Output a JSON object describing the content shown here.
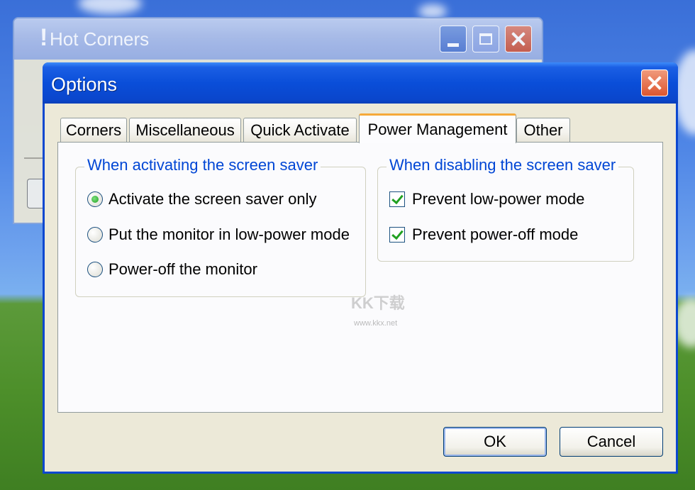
{
  "back_window": {
    "title": "Hot Corners",
    "icon": "exclamation-icon"
  },
  "dialog": {
    "title": "Options",
    "tabs": [
      {
        "label": "Corners",
        "active": false
      },
      {
        "label": "Miscellaneous",
        "active": false
      },
      {
        "label": "Quick Activate",
        "active": false
      },
      {
        "label": "Power Management",
        "active": true
      },
      {
        "label": "Other",
        "active": false
      }
    ],
    "activating_group": {
      "label": "When activating the screen saver",
      "options": [
        {
          "label": "Activate the screen saver only",
          "selected": true
        },
        {
          "label": "Put the monitor in low-power mode",
          "selected": false
        },
        {
          "label": "Power-off the monitor",
          "selected": false
        }
      ]
    },
    "disabling_group": {
      "label": "When disabling the screen saver",
      "options": [
        {
          "label": "Prevent low-power mode",
          "checked": true
        },
        {
          "label": "Prevent power-off mode",
          "checked": true
        }
      ]
    },
    "buttons": {
      "ok": "OK",
      "cancel": "Cancel"
    }
  },
  "watermark": {
    "text": "KK下载",
    "url": "www.kkx.net"
  },
  "colors": {
    "title_bar": "#0a4ed9",
    "group_label": "#0046d5",
    "active_tab_accent": "#f6a93a",
    "check_mark": "#21a121"
  }
}
